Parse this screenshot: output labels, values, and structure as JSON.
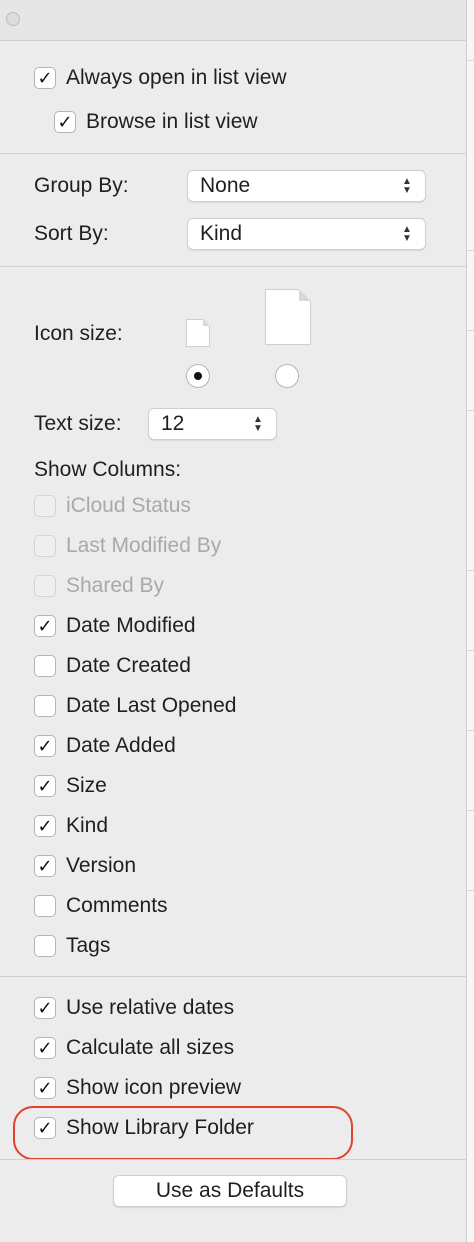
{
  "check_glyph": "✓",
  "colors": {
    "highlight": "#e0432c",
    "panel": "#ececec"
  },
  "top": {
    "always_open": {
      "label": "Always open in list view",
      "checked": true
    },
    "browse": {
      "label": "Browse in list view",
      "checked": true
    }
  },
  "group_by": {
    "label": "Group By:",
    "value": "None"
  },
  "sort_by": {
    "label": "Sort By:",
    "value": "Kind"
  },
  "icon_size": {
    "label": "Icon size:",
    "selected": "small"
  },
  "text_size": {
    "label": "Text size:",
    "value": "12"
  },
  "show_columns": {
    "label": "Show Columns:",
    "items": [
      {
        "label": "iCloud Status",
        "checked": false,
        "enabled": false
      },
      {
        "label": "Last Modified By",
        "checked": false,
        "enabled": false
      },
      {
        "label": "Shared By",
        "checked": false,
        "enabled": false
      },
      {
        "label": "Date Modified",
        "checked": true,
        "enabled": true
      },
      {
        "label": "Date Created",
        "checked": false,
        "enabled": true
      },
      {
        "label": "Date Last Opened",
        "checked": false,
        "enabled": true
      },
      {
        "label": "Date Added",
        "checked": true,
        "enabled": true
      },
      {
        "label": "Size",
        "checked": true,
        "enabled": true
      },
      {
        "label": "Kind",
        "checked": true,
        "enabled": true
      },
      {
        "label": "Version",
        "checked": true,
        "enabled": true
      },
      {
        "label": "Comments",
        "checked": false,
        "enabled": true
      },
      {
        "label": "Tags",
        "checked": false,
        "enabled": true
      }
    ]
  },
  "options": [
    {
      "label": "Use relative dates",
      "checked": true
    },
    {
      "label": "Calculate all sizes",
      "checked": true
    },
    {
      "label": "Show icon preview",
      "checked": true
    },
    {
      "label": "Show Library Folder",
      "checked": true
    }
  ],
  "defaults_button": "Use as Defaults"
}
